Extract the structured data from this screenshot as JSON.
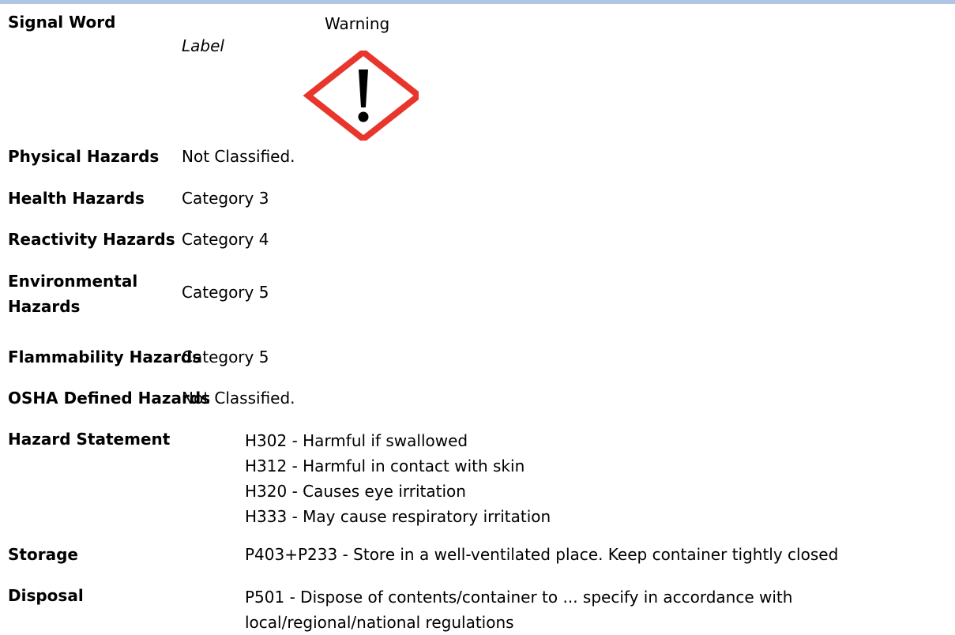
{
  "signal": {
    "label": "Signal Word",
    "value": "Warning",
    "label_caption": "Label",
    "pictogram_icon": "exclamation-mark-diamond-icon"
  },
  "rows": [
    {
      "label": "Physical Hazards",
      "value": "Not Classified."
    },
    {
      "label": "Health Hazards",
      "value": "Category 3"
    },
    {
      "label": "Reactivity Hazards",
      "value": "Category 4"
    },
    {
      "label": "Environmental Hazards",
      "value": "Category 5"
    },
    {
      "label": "Flammability Hazards",
      "value": "Category 5"
    },
    {
      "label": "OSHA Defined Hazards",
      "value": "Not Classified."
    }
  ],
  "hazard_statement": {
    "label": "Hazard Statement",
    "lines": [
      "H302 - Harmful if swallowed",
      "H312 - Harmful in contact with skin",
      "H320 - Causes eye irritation",
      "H333 - May cause respiratory irritation"
    ]
  },
  "storage": {
    "label": "Storage",
    "value": "P403+P233 - Store in a well-ventilated place. Keep container tightly closed"
  },
  "disposal": {
    "label": "Disposal",
    "lines": [
      "P501 - Dispose of contents/container to ... specify in accordance with",
      "local/regional/national regulations"
    ]
  },
  "colors": {
    "accent_bar": "#b0c4e4",
    "pictogram_border": "#e8362d"
  }
}
